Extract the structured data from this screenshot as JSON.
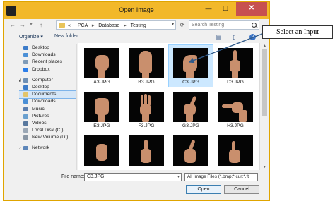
{
  "window": {
    "title": "Open Image",
    "controls": {
      "minimize": "—",
      "maximize": "☐",
      "close": "✕"
    }
  },
  "address_bar": {
    "prefix": "«",
    "crumbs": [
      "PCA",
      "Database",
      "Testing"
    ],
    "search_placeholder": "Search Testing"
  },
  "toolbar": {
    "organize": "Organize ▾",
    "new_folder": "New folder"
  },
  "sidebar": {
    "favorites": [
      "Desktop",
      "Downloads",
      "Recent places",
      "Dropbox"
    ],
    "computer_label": "Computer",
    "computer_items": [
      "Desktop",
      "Documents",
      "Downloads",
      "Music",
      "Pictures",
      "Videos",
      "Local Disk (C:)",
      "New Volume (D:)"
    ],
    "network_label": "Network",
    "selected": "Documents"
  },
  "files": [
    {
      "name": "A3.JPG",
      "gesture": "fist"
    },
    {
      "name": "B3.JPG",
      "gesture": "open-palm"
    },
    {
      "name": "C3.JPG",
      "gesture": "c-shape",
      "selected": true
    },
    {
      "name": "D3.JPG",
      "gesture": "index-up"
    },
    {
      "name": "E3.JPG",
      "gesture": "fist-thumb"
    },
    {
      "name": "F3.JPG",
      "gesture": "three-fingers"
    },
    {
      "name": "G3.JPG",
      "gesture": "point-side"
    },
    {
      "name": "H3.JPG",
      "gesture": "point-left"
    },
    {
      "name": "",
      "gesture": "partial"
    },
    {
      "name": "",
      "gesture": "partial"
    },
    {
      "name": "",
      "gesture": "partial"
    },
    {
      "name": "",
      "gesture": "partial"
    }
  ],
  "bottom": {
    "file_name_label": "File name:",
    "file_name_value": "C3.JPG",
    "file_type": "All Image Files (*.bmp;*.cur;*.ft",
    "open_label": "Open",
    "cancel_label": "Cancel"
  },
  "annotation": {
    "callout_text": "Select an Input"
  },
  "colors": {
    "title_bar": "#f2b82a",
    "close_button": "#c75050",
    "selection": "#cce8ff",
    "arrow": "#2f5a8a"
  }
}
